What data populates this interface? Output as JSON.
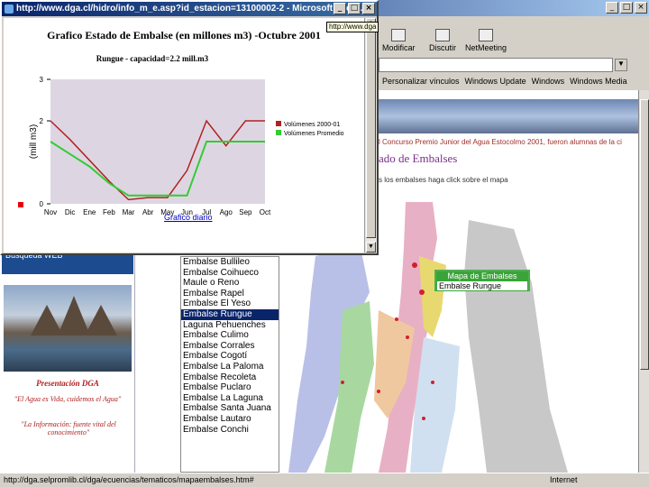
{
  "popup": {
    "title": "http://www.dga.cl/hidro/info_m_e.asp?id_estacion=13100002-2 - Microsoft Intern...",
    "tooltip": "http://www.dga",
    "link": "Grafico diario"
  },
  "chart_data": {
    "type": "line",
    "title": "Grafico Estado de Embalse (en millones m3) -Octubre 2001",
    "subtitle": "Rungue - capacidad=2.2 mill.m3",
    "ylabel": "(mill m3)",
    "ylim": [
      0,
      3
    ],
    "yticks": [
      "0",
      "2",
      "3"
    ],
    "categories": [
      "Nov",
      "Dic",
      "Ene",
      "Feb",
      "Mar",
      "Abr",
      "May",
      "Jun",
      "Jul",
      "Ago",
      "Sep",
      "Oct"
    ],
    "series": [
      {
        "name": "Volúmenes 2000-01",
        "color": "#b22222",
        "values": [
          2.0,
          1.55,
          1.05,
          0.55,
          0.1,
          0.15,
          0.15,
          0.8,
          2.0,
          1.4,
          2.0,
          2.0
        ]
      },
      {
        "name": "Volúmenes Promedio",
        "color": "#33cc33",
        "values": [
          1.5,
          1.2,
          0.9,
          0.5,
          0.2,
          0.2,
          0.2,
          0.2,
          1.5,
          1.5,
          1.5,
          1.5
        ]
      }
    ]
  },
  "toolbar": {
    "modificar": "Modificar",
    "discutir": "Discutir",
    "netmeeting": "NetMeeting"
  },
  "links": [
    "Personalizar vínculos",
    "Windows Update",
    "Windows",
    "Windows Media"
  ],
  "page": {
    "banner_caption": "l Concurso Premio Junior del Agua Estocolmo 2001, fueron alumnas de la ci",
    "section_title": "ado de Embalses",
    "section_sub": "s los embalses haga click sobre el mapa"
  },
  "sidebar": {
    "search": "Búsqueda WEB",
    "presentacion": "Presentación DGA",
    "quote1": "\"El Agua es Vida, cuidemos el Agua\"",
    "quote2": "\"La Información: fuente vital del conocimiento\""
  },
  "dams": [
    "Embalse Bullileo",
    "Embalse Coihueco",
    "Embalse Corrales",
    "Embalse Cogotí",
    "Embalse Rungue",
    "Laguna Pehuenches",
    "Embalse Culimo",
    "Embalse Recoleta",
    "Embalse Rapel",
    "Embalse El Yeso",
    "Embalse La Paloma",
    "Embalse Puclaro",
    "Embalse La Laguna",
    "Embalse Santa Juana",
    "Embalse Lautaro",
    "Embalse Conchi"
  ],
  "dams_display": [
    "Embalse Bullileo",
    "Embalse Coihueco",
    "Maule o Reno",
    "Embalse Rapel",
    "Embalse El Yeso",
    "Embalse Rungue",
    "Laguna Pehuenches",
    "Embalse Culimo",
    "Embalse Corrales",
    "Embalse Cogotí",
    "Embalse La Paloma",
    "Embalse Recoleta",
    "Embalse Puclaro",
    "Embalse La Laguna",
    "Embalse Santa Juana",
    "Embalse Lautaro",
    "Embalse Conchi"
  ],
  "map_tooltip": {
    "header": "Mapa de Embalses",
    "item": "Embalse Rungue"
  },
  "status": {
    "url": "http://dga.selpromlib.cl/dga/ecuencias/tematicos/mapaembalses.htm#",
    "zone": "Internet"
  },
  "colors": {
    "titlebar": "#0a246a",
    "selected": "#0a246a",
    "series_real": "#b22222",
    "series_avg": "#33cc33"
  }
}
